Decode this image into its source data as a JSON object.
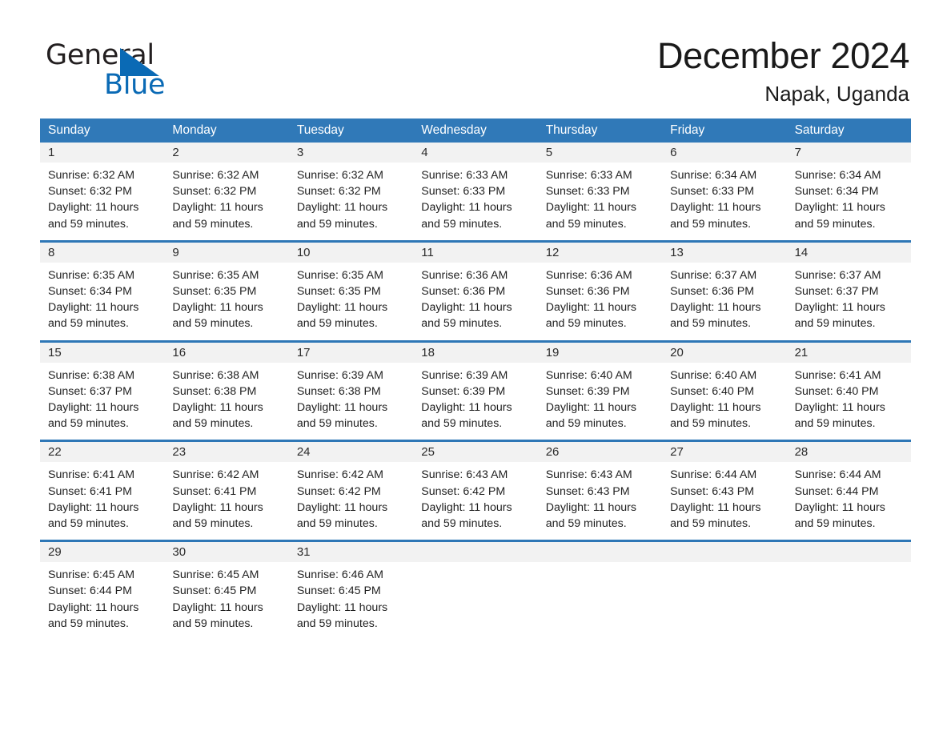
{
  "brand": {
    "name_part1": "General",
    "name_part2": "Blue",
    "triangle_color": "#0a6ab5",
    "text_color": "#231f20"
  },
  "header": {
    "month_title": "December 2024",
    "location": "Napak, Uganda"
  },
  "colors": {
    "header_blue": "#3079b8",
    "row_divider_blue": "#2e77b6",
    "date_band_gray": "#f2f2f2",
    "text": "#1a1a1a"
  },
  "weekday_headers": [
    "Sunday",
    "Monday",
    "Tuesday",
    "Wednesday",
    "Thursday",
    "Friday",
    "Saturday"
  ],
  "weeks": [
    {
      "days": [
        {
          "date": "1",
          "sunrise": "Sunrise: 6:32 AM",
          "sunset": "Sunset: 6:32 PM",
          "daylight": "Daylight: 11 hours and 59 minutes."
        },
        {
          "date": "2",
          "sunrise": "Sunrise: 6:32 AM",
          "sunset": "Sunset: 6:32 PM",
          "daylight": "Daylight: 11 hours and 59 minutes."
        },
        {
          "date": "3",
          "sunrise": "Sunrise: 6:32 AM",
          "sunset": "Sunset: 6:32 PM",
          "daylight": "Daylight: 11 hours and 59 minutes."
        },
        {
          "date": "4",
          "sunrise": "Sunrise: 6:33 AM",
          "sunset": "Sunset: 6:33 PM",
          "daylight": "Daylight: 11 hours and 59 minutes."
        },
        {
          "date": "5",
          "sunrise": "Sunrise: 6:33 AM",
          "sunset": "Sunset: 6:33 PM",
          "daylight": "Daylight: 11 hours and 59 minutes."
        },
        {
          "date": "6",
          "sunrise": "Sunrise: 6:34 AM",
          "sunset": "Sunset: 6:33 PM",
          "daylight": "Daylight: 11 hours and 59 minutes."
        },
        {
          "date": "7",
          "sunrise": "Sunrise: 6:34 AM",
          "sunset": "Sunset: 6:34 PM",
          "daylight": "Daylight: 11 hours and 59 minutes."
        }
      ]
    },
    {
      "days": [
        {
          "date": "8",
          "sunrise": "Sunrise: 6:35 AM",
          "sunset": "Sunset: 6:34 PM",
          "daylight": "Daylight: 11 hours and 59 minutes."
        },
        {
          "date": "9",
          "sunrise": "Sunrise: 6:35 AM",
          "sunset": "Sunset: 6:35 PM",
          "daylight": "Daylight: 11 hours and 59 minutes."
        },
        {
          "date": "10",
          "sunrise": "Sunrise: 6:35 AM",
          "sunset": "Sunset: 6:35 PM",
          "daylight": "Daylight: 11 hours and 59 minutes."
        },
        {
          "date": "11",
          "sunrise": "Sunrise: 6:36 AM",
          "sunset": "Sunset: 6:36 PM",
          "daylight": "Daylight: 11 hours and 59 minutes."
        },
        {
          "date": "12",
          "sunrise": "Sunrise: 6:36 AM",
          "sunset": "Sunset: 6:36 PM",
          "daylight": "Daylight: 11 hours and 59 minutes."
        },
        {
          "date": "13",
          "sunrise": "Sunrise: 6:37 AM",
          "sunset": "Sunset: 6:36 PM",
          "daylight": "Daylight: 11 hours and 59 minutes."
        },
        {
          "date": "14",
          "sunrise": "Sunrise: 6:37 AM",
          "sunset": "Sunset: 6:37 PM",
          "daylight": "Daylight: 11 hours and 59 minutes."
        }
      ]
    },
    {
      "days": [
        {
          "date": "15",
          "sunrise": "Sunrise: 6:38 AM",
          "sunset": "Sunset: 6:37 PM",
          "daylight": "Daylight: 11 hours and 59 minutes."
        },
        {
          "date": "16",
          "sunrise": "Sunrise: 6:38 AM",
          "sunset": "Sunset: 6:38 PM",
          "daylight": "Daylight: 11 hours and 59 minutes."
        },
        {
          "date": "17",
          "sunrise": "Sunrise: 6:39 AM",
          "sunset": "Sunset: 6:38 PM",
          "daylight": "Daylight: 11 hours and 59 minutes."
        },
        {
          "date": "18",
          "sunrise": "Sunrise: 6:39 AM",
          "sunset": "Sunset: 6:39 PM",
          "daylight": "Daylight: 11 hours and 59 minutes."
        },
        {
          "date": "19",
          "sunrise": "Sunrise: 6:40 AM",
          "sunset": "Sunset: 6:39 PM",
          "daylight": "Daylight: 11 hours and 59 minutes."
        },
        {
          "date": "20",
          "sunrise": "Sunrise: 6:40 AM",
          "sunset": "Sunset: 6:40 PM",
          "daylight": "Daylight: 11 hours and 59 minutes."
        },
        {
          "date": "21",
          "sunrise": "Sunrise: 6:41 AM",
          "sunset": "Sunset: 6:40 PM",
          "daylight": "Daylight: 11 hours and 59 minutes."
        }
      ]
    },
    {
      "days": [
        {
          "date": "22",
          "sunrise": "Sunrise: 6:41 AM",
          "sunset": "Sunset: 6:41 PM",
          "daylight": "Daylight: 11 hours and 59 minutes."
        },
        {
          "date": "23",
          "sunrise": "Sunrise: 6:42 AM",
          "sunset": "Sunset: 6:41 PM",
          "daylight": "Daylight: 11 hours and 59 minutes."
        },
        {
          "date": "24",
          "sunrise": "Sunrise: 6:42 AM",
          "sunset": "Sunset: 6:42 PM",
          "daylight": "Daylight: 11 hours and 59 minutes."
        },
        {
          "date": "25",
          "sunrise": "Sunrise: 6:43 AM",
          "sunset": "Sunset: 6:42 PM",
          "daylight": "Daylight: 11 hours and 59 minutes."
        },
        {
          "date": "26",
          "sunrise": "Sunrise: 6:43 AM",
          "sunset": "Sunset: 6:43 PM",
          "daylight": "Daylight: 11 hours and 59 minutes."
        },
        {
          "date": "27",
          "sunrise": "Sunrise: 6:44 AM",
          "sunset": "Sunset: 6:43 PM",
          "daylight": "Daylight: 11 hours and 59 minutes."
        },
        {
          "date": "28",
          "sunrise": "Sunrise: 6:44 AM",
          "sunset": "Sunset: 6:44 PM",
          "daylight": "Daylight: 11 hours and 59 minutes."
        }
      ]
    },
    {
      "days": [
        {
          "date": "29",
          "sunrise": "Sunrise: 6:45 AM",
          "sunset": "Sunset: 6:44 PM",
          "daylight": "Daylight: 11 hours and 59 minutes."
        },
        {
          "date": "30",
          "sunrise": "Sunrise: 6:45 AM",
          "sunset": "Sunset: 6:45 PM",
          "daylight": "Daylight: 11 hours and 59 minutes."
        },
        {
          "date": "31",
          "sunrise": "Sunrise: 6:46 AM",
          "sunset": "Sunset: 6:45 PM",
          "daylight": "Daylight: 11 hours and 59 minutes."
        },
        {
          "date": "",
          "sunrise": "",
          "sunset": "",
          "daylight": ""
        },
        {
          "date": "",
          "sunrise": "",
          "sunset": "",
          "daylight": ""
        },
        {
          "date": "",
          "sunrise": "",
          "sunset": "",
          "daylight": ""
        },
        {
          "date": "",
          "sunrise": "",
          "sunset": "",
          "daylight": ""
        }
      ]
    }
  ]
}
